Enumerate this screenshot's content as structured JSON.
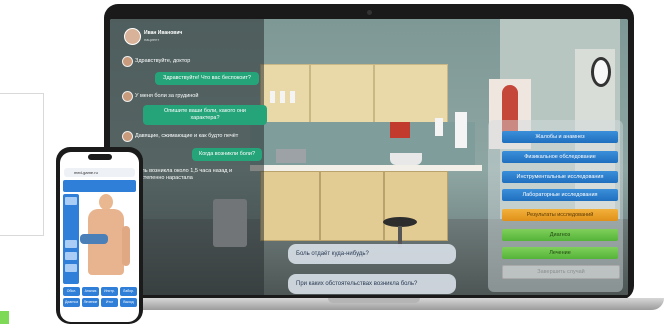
{
  "chat": {
    "doctor_name": "Иван Иванович",
    "doctor_role": "пациент",
    "messages": [
      {
        "side": "left",
        "text": "Здравствуйте, доктор"
      },
      {
        "side": "right",
        "text": "Здравствуйте! Что вас беспокоит?"
      },
      {
        "side": "left",
        "text": "У меня боли за грудиной"
      },
      {
        "side": "right",
        "text": "Опишите ваши боли, какого они характера?"
      },
      {
        "side": "left",
        "text": "Давящие, сжимающие и как будто печёт"
      },
      {
        "side": "right",
        "text": "Когда возникли боли?"
      },
      {
        "side": "left",
        "text": "Боль возникла около 1,5 часа назад и постепенно нарастала"
      }
    ]
  },
  "questions": [
    "Боль отдаёт куда-нибудь?",
    "При каких обстоятельствах возникла боль?"
  ],
  "menu": {
    "items": [
      {
        "label": "Жалобы и анамнез",
        "style": "blue"
      },
      {
        "label": "Физикальное обследование",
        "style": "blue"
      },
      {
        "label": "Инструментальные исследования",
        "style": "blue"
      },
      {
        "label": "Лабораторные исследования",
        "style": "blue"
      },
      {
        "label": "Результаты исследований",
        "style": "orange"
      },
      {
        "label": "Диагноз",
        "style": "green"
      },
      {
        "label": "Лечение",
        "style": "green"
      },
      {
        "label": "Завершить случай",
        "style": "disabled"
      }
    ]
  },
  "phone": {
    "url": "med-game.ru",
    "bottom_buttons": [
      "Обсл.",
      "Анализ",
      "Инстр.",
      "Лабор.",
      "Диагноз",
      "Лечение",
      "Итог",
      "Выход"
    ]
  },
  "colors": {
    "chat_right_bubble": "#25a47a",
    "menu_blue": "#2a7fd0",
    "menu_orange": "#f0a52a",
    "menu_green": "#6cc64a",
    "accent_square": "#7ed957"
  }
}
